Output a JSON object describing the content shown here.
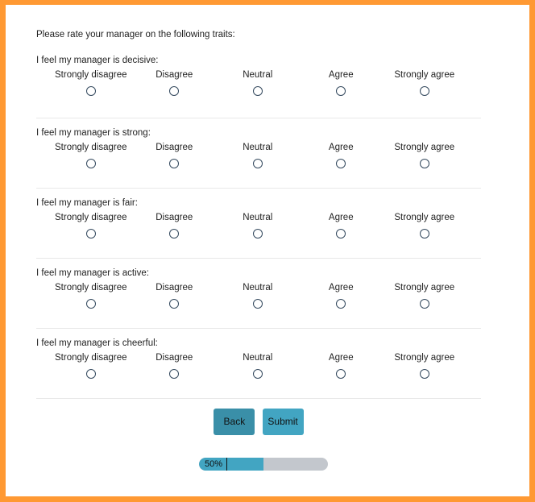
{
  "intro": "Please rate your manager on the following traits:",
  "scale": [
    "Strongly disagree",
    "Disagree",
    "Neutral",
    "Agree",
    "Strongly agree"
  ],
  "questions": [
    {
      "label": "I feel my manager is decisive:"
    },
    {
      "label": "I feel my manager is strong:"
    },
    {
      "label": "I feel my manager is fair:"
    },
    {
      "label": "I feel my manager is active:"
    },
    {
      "label": "I feel my manager is cheerful:"
    }
  ],
  "buttons": {
    "back": "Back",
    "submit": "Submit"
  },
  "progress": {
    "percent": 50,
    "label": "50%"
  },
  "colors": {
    "border": "#ff9933",
    "accent": "#42a5c2",
    "back": "#3a8fa8",
    "track": "#c3c7cd"
  }
}
